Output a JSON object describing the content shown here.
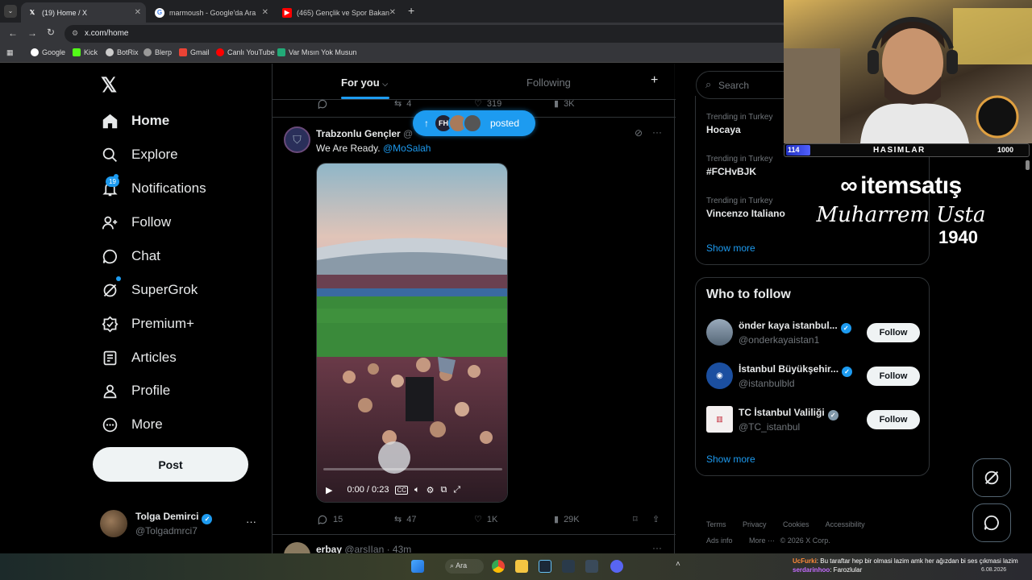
{
  "browser": {
    "tabs": [
      {
        "title": "(19) Home / X",
        "favicon": "x-logo"
      },
      {
        "title": "marmoush - Google'da Ara",
        "favicon": "google"
      },
      {
        "title": "(465) Gençlik ve Spor Bakanı O",
        "favicon": "youtube"
      }
    ],
    "url": "x.com/home",
    "bookmarks": [
      "Google",
      "Kick",
      "BotRix",
      "Blerp",
      "Gmail",
      "Canlı YouTube",
      "Var Mısın Yok Musun"
    ]
  },
  "nav": {
    "items": [
      {
        "label": "Home",
        "icon": "home-icon"
      },
      {
        "label": "Explore",
        "icon": "search-icon"
      },
      {
        "label": "Notifications",
        "icon": "bell-icon",
        "badge": "19"
      },
      {
        "label": "Follow",
        "icon": "follow-icon"
      },
      {
        "label": "Chat",
        "icon": "chat-icon"
      },
      {
        "label": "SuperGrok",
        "icon": "grok-icon"
      },
      {
        "label": "Premium+",
        "icon": "premium-icon"
      },
      {
        "label": "Articles",
        "icon": "articles-icon"
      },
      {
        "label": "Profile",
        "icon": "profile-icon"
      },
      {
        "label": "More",
        "icon": "more-icon"
      }
    ],
    "post_label": "Post",
    "account": {
      "name": "Tolga Demirci",
      "handle": "@Tolgadmrci7"
    }
  },
  "feed": {
    "tabs": [
      "For you",
      "Following"
    ],
    "prev_stats": {
      "replies": "",
      "reposts": "4",
      "likes": "319",
      "views": "3K"
    },
    "posted_pill": "posted",
    "tweet": {
      "author": "Trabzonlu Gençler",
      "handle": "@",
      "text_prefix": "We Are Ready. ",
      "mention": "@MoSalah",
      "video_time": "0:00 / 0:23",
      "stats": {
        "replies": "15",
        "reposts": "47",
        "likes": "1K",
        "views": "29K"
      }
    },
    "next_tweet": {
      "author": "erbay",
      "handle": "@arsIIan",
      "time": "· 43m"
    }
  },
  "sidebar": {
    "search_placeholder": "Search",
    "trends": [
      {
        "category": "Trending in Turkey",
        "name": "Hocaya"
      },
      {
        "category": "Trending in Turkey",
        "name": "#FCHvBJK"
      },
      {
        "category": "Trending in Turkey",
        "name": "Vincenzo Italiano"
      }
    ],
    "show_more": "Show more",
    "who_to_follow": {
      "title": "Who to follow",
      "users": [
        {
          "name": "önder kaya istanbul...",
          "handle": "@onderkayaistan1",
          "verified": "blue"
        },
        {
          "name": "İstanbul Büyükşehir...",
          "handle": "@istanbulbld",
          "verified": "blue"
        },
        {
          "name": "TC İstanbul Valiliği",
          "handle": "@TC_istanbul",
          "verified": "gray"
        }
      ],
      "follow_label": "Follow",
      "show_more": "Show more"
    },
    "footer": [
      "Terms",
      "Privacy",
      "Cookies",
      "Accessibility",
      "Ads info",
      "More ···",
      "© 2026 X Corp."
    ]
  },
  "overlay": {
    "cam_label": "HASIMLAR",
    "cam_left": "114",
    "cam_right": "1000",
    "sponsor": "itemsatış",
    "signature": "Muharrem Usta",
    "year": "1940"
  },
  "taskbar": {
    "search": "Ara",
    "chat_user1": "UcFurki",
    "chat_msg1": ": Bu taraftar hep bir olmasi lazim amk her ağızdan bi ses çıkmasi lazim",
    "chat_user2": "serdarinhoo",
    "chat_msg2": ": Farozlular",
    "date": "6.08.2026"
  },
  "colors": {
    "accent": "#1d9bf0",
    "bg": "#000000",
    "border": "#2f3336",
    "muted": "#71767b"
  }
}
